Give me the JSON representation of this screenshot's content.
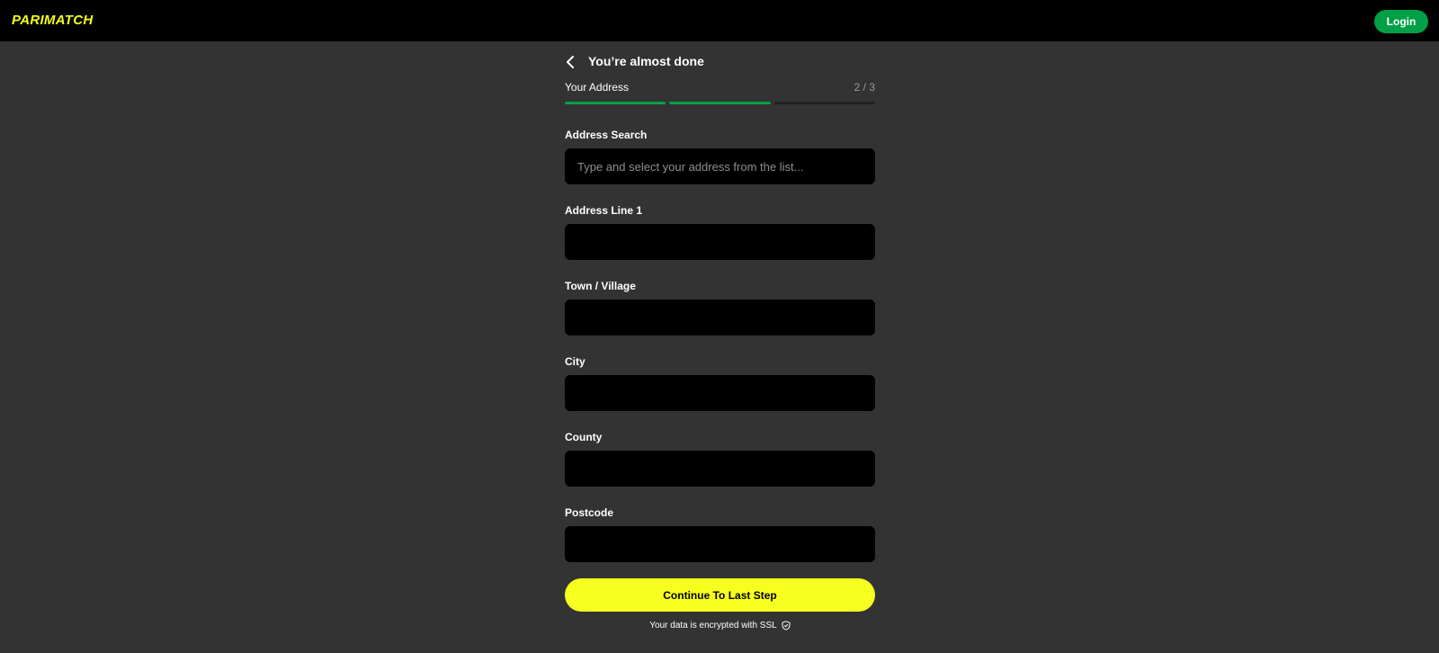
{
  "topbar": {
    "logo_text": "PARIMATCH",
    "login_label": "Login"
  },
  "header": {
    "title": "You’re almost done",
    "back_icon": "chevron-left-icon"
  },
  "step": {
    "label": "Your Address",
    "count": "2 / 3",
    "progress_completed": 2,
    "progress_total": 3
  },
  "fields": [
    {
      "label": "Address Search",
      "placeholder": "Type and select your address from the list...",
      "value": ""
    },
    {
      "label": "Address Line 1",
      "placeholder": "",
      "value": ""
    },
    {
      "label": "Town / Village",
      "placeholder": "",
      "value": ""
    },
    {
      "label": "City",
      "placeholder": "",
      "value": ""
    },
    {
      "label": "County",
      "placeholder": "",
      "value": ""
    },
    {
      "label": "Postcode",
      "placeholder": "",
      "value": ""
    }
  ],
  "continue_label": "Continue To Last Step",
  "ssl_note": "Your data is encrypted with SSL",
  "ssl_icon": "shield-check-icon",
  "colors": {
    "brand_yellow": "#f7ff1e",
    "brand_green": "#00a046",
    "background": "#333333",
    "topbar": "#000000"
  }
}
